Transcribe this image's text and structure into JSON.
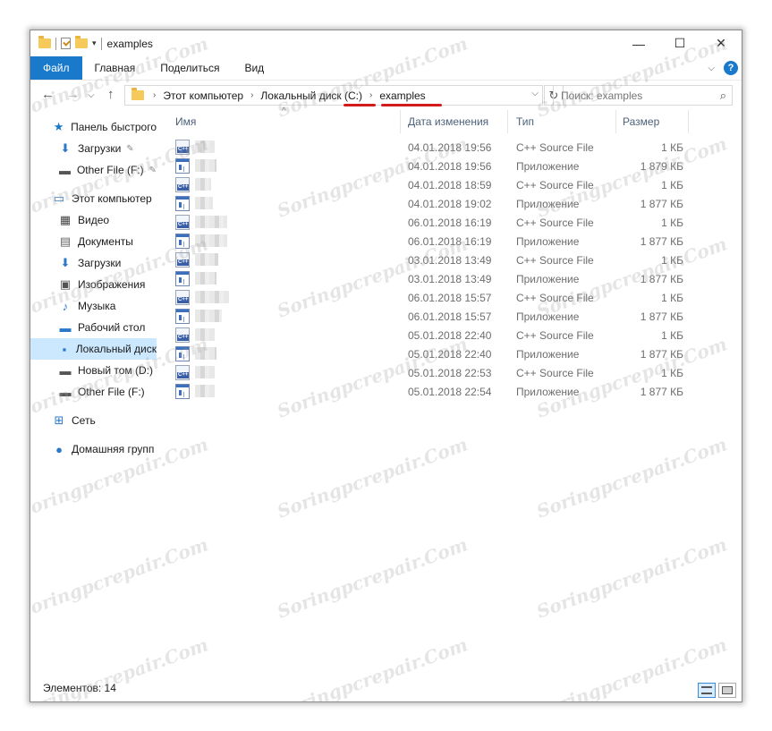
{
  "window": {
    "title": "examples"
  },
  "ribbon": {
    "tabs": [
      "Файл",
      "Главная",
      "Поделиться",
      "Вид"
    ]
  },
  "nav": {
    "breadcrumbs": [
      "Этот компьютер",
      "Локальный диск (C:)",
      "examples"
    ],
    "search_placeholder": "Поиск: examples"
  },
  "sidebar": {
    "items": [
      {
        "label": "Панель быстрого",
        "icon": "star-icon"
      },
      {
        "label": "Загрузки",
        "icon": "download-icon"
      },
      {
        "label": "Other File (F:)",
        "icon": "drive-icon"
      },
      {
        "label": "Этот компьютер",
        "icon": "computer-icon"
      },
      {
        "label": "Видео",
        "icon": "video-icon"
      },
      {
        "label": "Документы",
        "icon": "documents-icon"
      },
      {
        "label": "Загрузки",
        "icon": "download-icon"
      },
      {
        "label": "Изображения",
        "icon": "pictures-icon"
      },
      {
        "label": "Музыка",
        "icon": "music-icon"
      },
      {
        "label": "Рабочий стол",
        "icon": "desktop-icon"
      },
      {
        "label": "Локальный диск",
        "icon": "local-disk-icon"
      },
      {
        "label": "Новый том (D:)",
        "icon": "drive-icon"
      },
      {
        "label": "Other File (F:)",
        "icon": "drive-icon"
      },
      {
        "label": "Сеть",
        "icon": "network-icon"
      },
      {
        "label": "Домашняя групп",
        "icon": "homegroup-icon"
      }
    ]
  },
  "list": {
    "columns": [
      "Имя",
      "Дата изменения",
      "Тип",
      "Размер"
    ],
    "rows": [
      {
        "date": "04.01.2018 19:56",
        "type": "C++ Source File",
        "size": "1 КБ",
        "icon": "cpp-file-icon"
      },
      {
        "date": "04.01.2018 19:56",
        "type": "Приложение",
        "size": "1 879 КБ",
        "icon": "exe-file-icon"
      },
      {
        "date": "04.01.2018 18:59",
        "type": "C++ Source File",
        "size": "1 КБ",
        "icon": "cpp-file-icon"
      },
      {
        "date": "04.01.2018 19:02",
        "type": "Приложение",
        "size": "1 877 КБ",
        "icon": "exe-file-icon"
      },
      {
        "date": "06.01.2018 16:19",
        "type": "C++ Source File",
        "size": "1 КБ",
        "icon": "cpp-file-icon"
      },
      {
        "date": "06.01.2018 16:19",
        "type": "Приложение",
        "size": "1 877 КБ",
        "icon": "exe-file-icon"
      },
      {
        "date": "03.01.2018 13:49",
        "type": "C++ Source File",
        "size": "1 КБ",
        "icon": "cpp-file-icon"
      },
      {
        "date": "03.01.2018 13:49",
        "type": "Приложение",
        "size": "1 877 КБ",
        "icon": "exe-file-icon"
      },
      {
        "date": "06.01.2018 15:57",
        "type": "C++ Source File",
        "size": "1 КБ",
        "icon": "cpp-file-icon"
      },
      {
        "date": "06.01.2018 15:57",
        "type": "Приложение",
        "size": "1 877 КБ",
        "icon": "exe-file-icon"
      },
      {
        "date": "05.01.2018 22:40",
        "type": "C++ Source File",
        "size": "1 КБ",
        "icon": "cpp-file-icon"
      },
      {
        "date": "05.01.2018 22:40",
        "type": "Приложение",
        "size": "1 877 КБ",
        "icon": "exe-file-icon"
      },
      {
        "date": "05.01.2018 22:53",
        "type": "C++ Source File",
        "size": "1 КБ",
        "icon": "cpp-file-icon"
      },
      {
        "date": "05.01.2018 22:54",
        "type": "Приложение",
        "size": "1 877 КБ",
        "icon": "exe-file-icon"
      }
    ]
  },
  "status": {
    "items_count": "Элементов: 14"
  },
  "watermark": "Soringpcrepair.Com",
  "colors": {
    "accent": "#1979ca",
    "selected": "#cce8ff",
    "annotation": "#d41b1b"
  }
}
